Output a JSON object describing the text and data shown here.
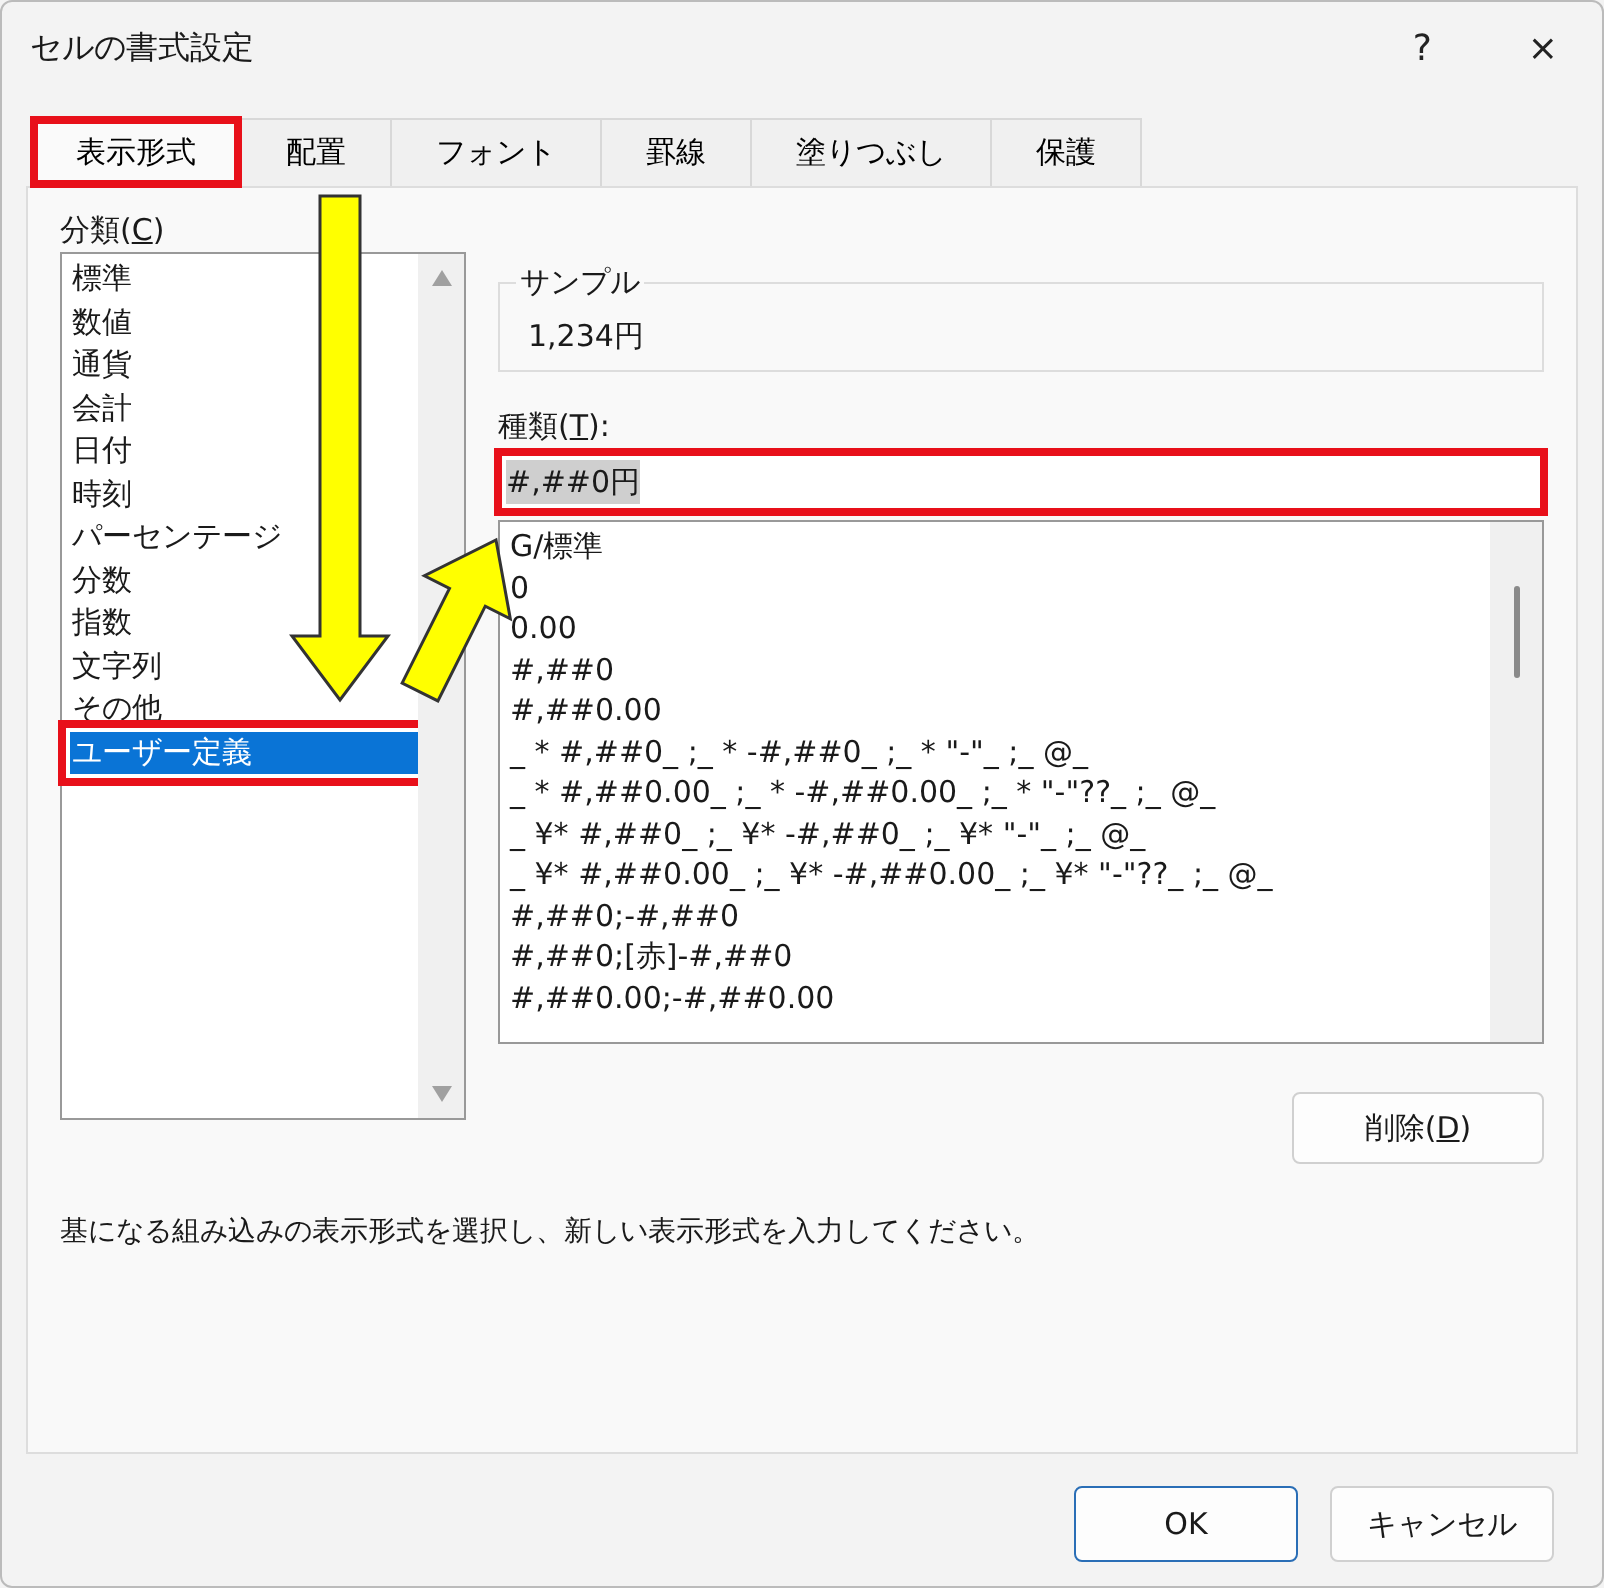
{
  "window": {
    "title": "セルの書式設定",
    "help": "?",
    "close": "×"
  },
  "tabs": [
    {
      "label": "表示形式",
      "selected": true,
      "highlighted": true
    },
    {
      "label": "配置",
      "selected": false,
      "highlighted": false
    },
    {
      "label": "フォント",
      "selected": false,
      "highlighted": false
    },
    {
      "label": "罫線",
      "selected": false,
      "highlighted": false
    },
    {
      "label": "塗りつぶし",
      "selected": false,
      "highlighted": false
    },
    {
      "label": "保護",
      "selected": false,
      "highlighted": false
    }
  ],
  "category": {
    "label": {
      "before": "分類(",
      "key": "C",
      "after": ")"
    },
    "items": [
      {
        "label": "標準",
        "selected": false,
        "highlighted": false
      },
      {
        "label": "数値",
        "selected": false,
        "highlighted": false
      },
      {
        "label": "通貨",
        "selected": false,
        "highlighted": false
      },
      {
        "label": "会計",
        "selected": false,
        "highlighted": false
      },
      {
        "label": "日付",
        "selected": false,
        "highlighted": false
      },
      {
        "label": "時刻",
        "selected": false,
        "highlighted": false
      },
      {
        "label": "パーセンテージ",
        "selected": false,
        "highlighted": false
      },
      {
        "label": "分数",
        "selected": false,
        "highlighted": false
      },
      {
        "label": "指数",
        "selected": false,
        "highlighted": false
      },
      {
        "label": "文字列",
        "selected": false,
        "highlighted": false
      },
      {
        "label": "その他",
        "selected": false,
        "highlighted": false
      },
      {
        "label": "ユーザー定義",
        "selected": true,
        "highlighted": true
      }
    ]
  },
  "sample": {
    "legend": "サンプル",
    "value": "1,234円"
  },
  "type": {
    "label": {
      "before": "種類(",
      "key": "T",
      "after": "):"
    },
    "value": "#,##0円",
    "highlighted": true,
    "items": [
      "G/標準",
      "0",
      "0.00",
      "#,##0",
      "#,##0.00",
      "_ * #,##0_ ;_ * -#,##0_ ;_ * \"-\"_ ;_ @_",
      "_ * #,##0.00_ ;_ * -#,##0.00_ ;_ * \"-\"??_ ;_ @_",
      "_ ¥* #,##0_ ;_ ¥* -#,##0_ ;_ ¥* \"-\"_ ;_ @_",
      "_ ¥* #,##0.00_ ;_ ¥* -#,##0.00_ ;_ ¥* \"-\"??_ ;_ @_",
      "#,##0;-#,##0",
      "#,##0;[赤]-#,##0",
      "#,##0.00;-#,##0.00"
    ]
  },
  "delete_button": {
    "before": "削除(",
    "key": "D",
    "after": ")"
  },
  "hint": "基になる組み込みの表示形式を選択し、新しい表示形式を入力してください。",
  "annotation_arrows": {
    "down": true,
    "diagonal": true
  },
  "buttons": [
    {
      "label": "OK",
      "default": true
    },
    {
      "label": "キャンセル",
      "default": false
    }
  ]
}
